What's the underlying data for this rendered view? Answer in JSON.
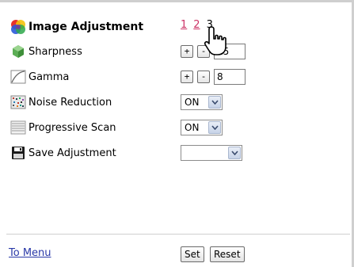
{
  "header": {
    "title": "Image Adjustment",
    "pages": [
      {
        "label": "1",
        "current": false
      },
      {
        "label": "2",
        "current": false
      },
      {
        "label": "3",
        "current": true
      }
    ]
  },
  "settings": {
    "sharpness": {
      "label": "Sharpness",
      "plus": "+",
      "minus": "-",
      "value": "15"
    },
    "gamma": {
      "label": "Gamma",
      "plus": "+",
      "minus": "-",
      "value": "8"
    },
    "noise_reduction": {
      "label": "Noise Reduction",
      "value": "ON"
    },
    "progressive_scan": {
      "label": "Progressive Scan",
      "value": "ON"
    },
    "save_adjustment": {
      "label": "Save Adjustment",
      "value": ""
    }
  },
  "footer": {
    "to_menu": "To Menu",
    "set_label": "Set",
    "reset_label": "Reset"
  },
  "colors": {
    "page_link": "#cc3366",
    "menu_link": "#2a39a8",
    "frame": "#cfcfcf"
  },
  "icons": [
    "image-adjustment-icon",
    "sharpness-icon",
    "gamma-icon",
    "noise-reduction-icon",
    "progressive-scan-icon",
    "save-icon",
    "hand-pointer-cursor-icon"
  ]
}
